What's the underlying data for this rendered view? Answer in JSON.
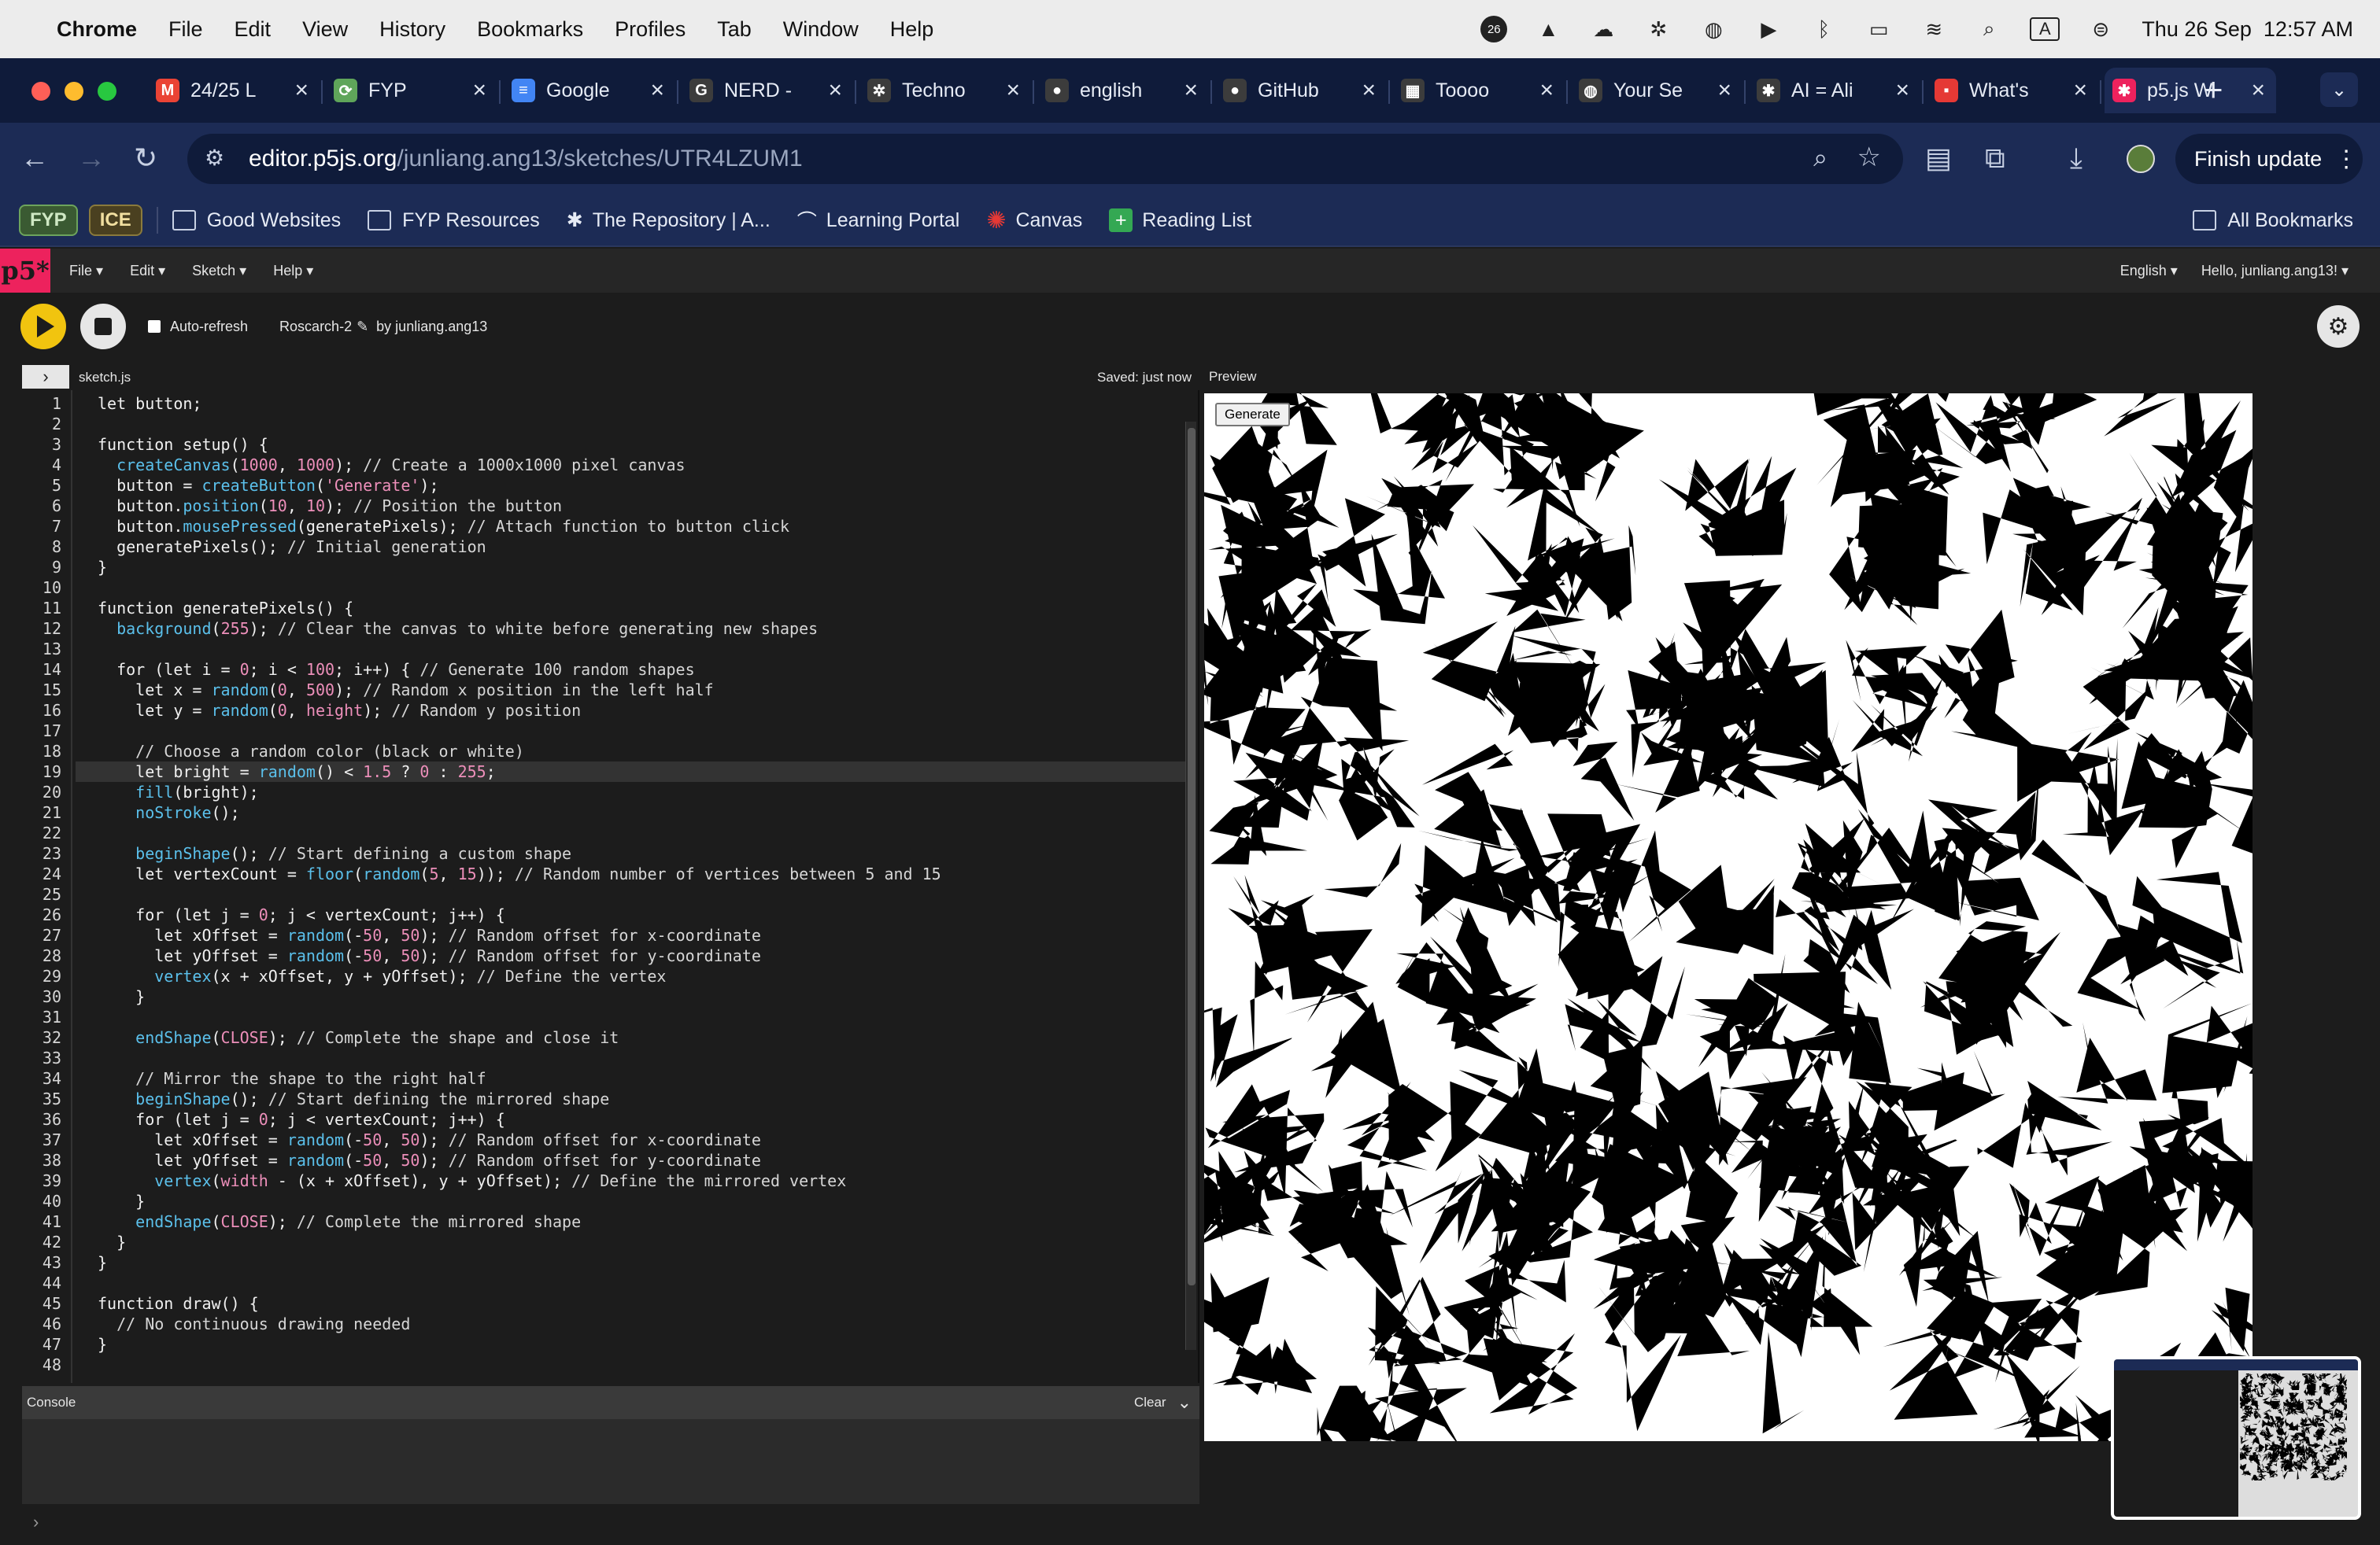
{
  "menubar": {
    "app": "Chrome",
    "items": [
      "File",
      "Edit",
      "View",
      "History",
      "Bookmarks",
      "Profiles",
      "Tab",
      "Window",
      "Help"
    ],
    "clock": "Thu 26 Sep  12:57 AM",
    "notif_count": "26",
    "input_source": "A"
  },
  "tabs": [
    {
      "label": "24/25 L",
      "favicon": "gmail-icon",
      "color": "#ea4335",
      "glyph": "M"
    },
    {
      "label": "FYP",
      "favicon": "group-icon",
      "color": "#5fa55a",
      "glyph": "⟳"
    },
    {
      "label": "Google",
      "favicon": "docs-icon",
      "color": "#4285f4",
      "glyph": "≡"
    },
    {
      "label": "NERD -",
      "favicon": "g-icon",
      "color": "#3c3c3c",
      "glyph": "G"
    },
    {
      "label": "Techno",
      "favicon": "openai-icon",
      "color": "#3c3c3c",
      "glyph": "✲"
    },
    {
      "label": "english",
      "favicon": "github-icon",
      "color": "#3c3c3c",
      "glyph": "●"
    },
    {
      "label": "GitHub",
      "favicon": "github-icon",
      "color": "#3c3c3c",
      "glyph": "●"
    },
    {
      "label": "Toooo",
      "favicon": "grid-icon",
      "color": "#3c3c3c",
      "glyph": "▦"
    },
    {
      "label": "Your Se",
      "favicon": "globe-icon",
      "color": "#3c3c3c",
      "glyph": "◍"
    },
    {
      "label": "AI = Ali",
      "favicon": "sparkle-icon",
      "color": "#3c3c3c",
      "glyph": "✱"
    },
    {
      "label": "What's",
      "favicon": "red-square-icon",
      "color": "#e53935",
      "glyph": "▪"
    },
    {
      "label": "p5.js W",
      "favicon": "p5-asterisk-icon",
      "color": "#ed225d",
      "glyph": "✱"
    }
  ],
  "address": {
    "domain": "editor.p5js.org",
    "path": "/junliang.ang13/sketches/UTR4LZUM1"
  },
  "finish_update": "Finish update",
  "bookmarks": {
    "pills": [
      "FYP",
      "ICE"
    ],
    "items": [
      "Good Websites",
      "FYP Resources",
      "The Repository | A...",
      "Learning Portal",
      "Canvas",
      "Reading List"
    ],
    "all": "All Bookmarks"
  },
  "p5": {
    "logo": "p5*",
    "menus": [
      "File",
      "Edit",
      "Sketch",
      "Help"
    ],
    "language": "English",
    "user": "Hello, junliang.ang13!",
    "auto_refresh": "Auto-refresh",
    "sketch_name": "Roscarch-2",
    "by": "by junliang.ang13",
    "file": "sketch.js",
    "saved": "Saved: just now",
    "preview": "Preview",
    "console": "Console",
    "clear": "Clear",
    "generate": "Generate",
    "prompt": "›"
  },
  "code": [
    "let button;",
    "",
    "function setup() {",
    "  createCanvas(1000, 1000); // Create a 1000x1000 pixel canvas",
    "  button = createButton('Generate');",
    "  button.position(10, 10); // Position the button",
    "  button.mousePressed(generatePixels); // Attach function to button click",
    "  generatePixels(); // Initial generation",
    "}",
    "",
    "function generatePixels() {",
    "  background(255); // Clear the canvas to white before generating new shapes",
    "",
    "  for (let i = 0; i < 100; i++) { // Generate 100 random shapes",
    "    let x = random(0, 500); // Random x position in the left half",
    "    let y = random(0, height); // Random y position",
    "",
    "    // Choose a random color (black or white)",
    "    let bright = random() < 1.5 ? 0 : 255;",
    "    fill(bright);",
    "    noStroke();",
    "",
    "    beginShape(); // Start defining a custom shape",
    "    let vertexCount = floor(random(5, 15)); // Random number of vertices between 5 and 15",
    "",
    "    for (let j = 0; j < vertexCount; j++) {",
    "      let xOffset = random(-50, 50); // Random offset for x-coordinate",
    "      let yOffset = random(-50, 50); // Random offset for y-coordinate",
    "      vertex(x + xOffset, y + yOffset); // Define the vertex",
    "    }",
    "",
    "    endShape(CLOSE); // Complete the shape and close it",
    "",
    "    // Mirror the shape to the right half",
    "    beginShape(); // Start defining the mirrored shape",
    "    for (let j = 0; j < vertexCount; j++) {",
    "      let xOffset = random(-50, 50); // Random offset for x-coordinate",
    "      let yOffset = random(-50, 50); // Random offset for y-coordinate",
    "      vertex(width - (x + xOffset), y + yOffset); // Define the mirrored vertex",
    "    }",
    "    endShape(CLOSE); // Complete the mirrored shape",
    "  }",
    "}",
    "",
    "function draw() {",
    "  // No continuous drawing needed",
    "}",
    ""
  ],
  "highlighted_line": 19
}
